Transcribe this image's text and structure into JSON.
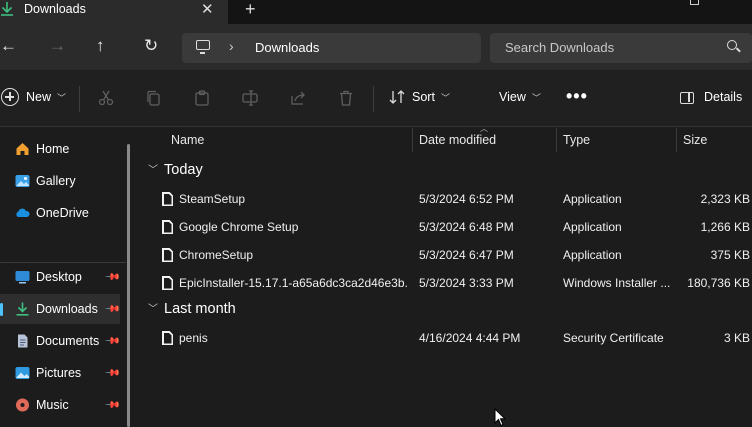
{
  "window": {
    "tab_title": "Downloads",
    "tab_close": "✕",
    "new_tab": "+"
  },
  "nav": {
    "back": "←",
    "forward": "→",
    "up": "↑",
    "refresh": "↻",
    "breadcrumb_sep": "›",
    "breadcrumb": "Downloads",
    "search_placeholder": "Search Downloads"
  },
  "commands": {
    "new_label": "New",
    "sort_label": "Sort",
    "view_label": "View",
    "more_label": "•••",
    "details_label": "Details",
    "cut_icon": "scissors-icon",
    "copy_icon": "copy-icon",
    "paste_icon": "paste-icon",
    "rename_icon": "rename-icon",
    "share_icon": "share-icon",
    "delete_icon": "trash-icon"
  },
  "sidebar": {
    "items": [
      {
        "label": "Home",
        "icon": "home-icon",
        "color": "#f0a030"
      },
      {
        "label": "Gallery",
        "icon": "gallery-icon",
        "color": "#3aa0e8"
      },
      {
        "label": "OneDrive",
        "icon": "onedrive-icon",
        "color": "#1a8fe0"
      },
      {
        "label": "Desktop",
        "icon": "desktop-icon",
        "color": "#2f8ad8"
      },
      {
        "label": "Downloads",
        "icon": "downloads-icon",
        "color": "#3fbf7f"
      },
      {
        "label": "Documents",
        "icon": "documents-icon",
        "color": "#b8c4d8"
      },
      {
        "label": "Pictures",
        "icon": "pictures-icon",
        "color": "#2f9ae0"
      },
      {
        "label": "Music",
        "icon": "music-icon",
        "color": "#e06a5a"
      }
    ]
  },
  "columns": {
    "name": "Name",
    "date": "Date modified",
    "type": "Type",
    "size": "Size"
  },
  "groups": [
    {
      "label": "Today",
      "files": [
        {
          "name": "SteamSetup",
          "date": "5/3/2024 6:52 PM",
          "type": "Application",
          "size": "2,323 KB"
        },
        {
          "name": "Google Chrome Setup",
          "date": "5/3/2024 6:48 PM",
          "type": "Application",
          "size": "1,266 KB"
        },
        {
          "name": "ChromeSetup",
          "date": "5/3/2024 6:47 PM",
          "type": "Application",
          "size": "375 KB"
        },
        {
          "name": "EpicInstaller-15.17.1-a65a6dc3ca2d46e3b...",
          "date": "5/3/2024 3:33 PM",
          "type": "Windows Installer ...",
          "size": "180,736 KB"
        }
      ]
    },
    {
      "label": "Last month",
      "files": [
        {
          "name": "penis",
          "date": "4/16/2024 4:44 PM",
          "type": "Security Certificate",
          "size": "3 KB"
        }
      ]
    }
  ]
}
